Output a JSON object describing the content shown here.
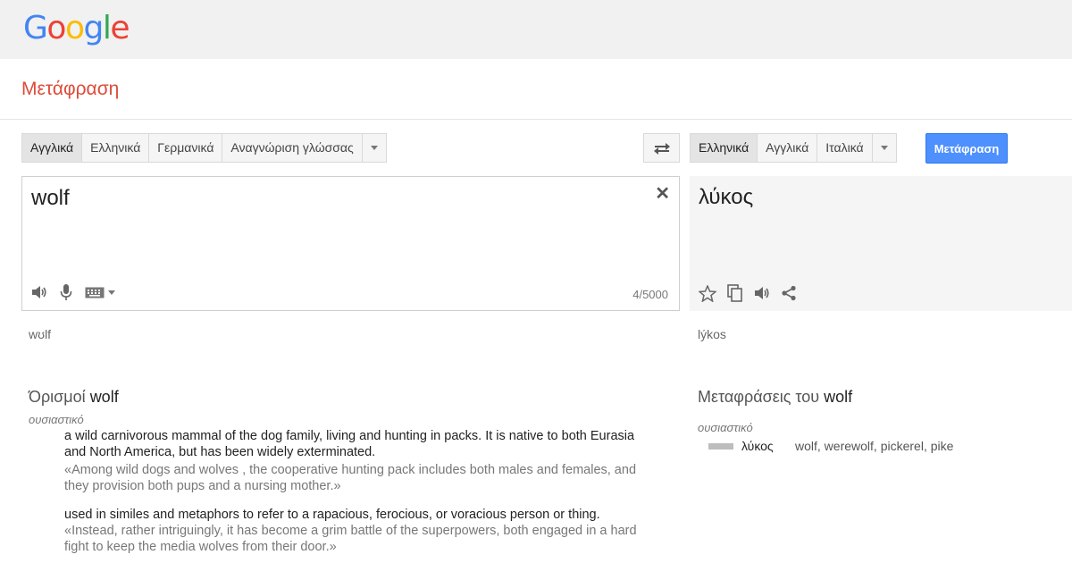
{
  "header": {
    "logo_letters": [
      {
        "char": "G",
        "color": "#4285F4"
      },
      {
        "char": "o",
        "color": "#EA4335"
      },
      {
        "char": "o",
        "color": "#FBBC05"
      },
      {
        "char": "g",
        "color": "#4285F4"
      },
      {
        "char": "l",
        "color": "#34A853"
      },
      {
        "char": "e",
        "color": "#EA4335"
      }
    ],
    "page_title": "Μετάφραση"
  },
  "source_langs": {
    "items": [
      "Αγγλικά",
      "Ελληνικά",
      "Γερμανικά",
      "Αναγνώριση γλώσσας"
    ],
    "active_index": 0
  },
  "target_langs": {
    "items": [
      "Ελληνικά",
      "Αγγλικά",
      "Ιταλικά"
    ],
    "active_index": 0
  },
  "translate_button": "Μετάφραση",
  "source": {
    "text": "wolf",
    "counter": "4/5000",
    "transliteration": "wʊlf"
  },
  "target": {
    "text": "λύκος",
    "transliteration": "lýkos"
  },
  "definitions": {
    "title_prefix": "Όρισμοί",
    "title_word": "wolf",
    "part_of_speech": "ουσιαστικό",
    "entries": [
      {
        "definition": "a wild carnivorous mammal of the dog family, living and hunting in packs. It is native to both Eurasia and North America, but has been widely exterminated.",
        "example": "«Among wild dogs and wolves , the cooperative hunting pack includes both males and females, and they provision both pups and a nursing mother.»"
      },
      {
        "definition": "used in similes and metaphors to refer to a rapacious, ferocious, or voracious person or thing.",
        "example": "«Instead, rather intriguingly, it has become a grim battle of the superpowers, both engaged in a hard fight to keep the media wolves from their door.»"
      }
    ]
  },
  "translations": {
    "title_prefix": "Μεταφράσεις του",
    "title_word": "wolf",
    "part_of_speech": "ουσιαστικό",
    "rows": [
      {
        "word": "λύκος",
        "synonyms": "wolf, werewolf, pickerel, pike"
      }
    ]
  },
  "colors": {
    "title_red": "#dd4b39",
    "button_blue": "#4d90fe"
  }
}
